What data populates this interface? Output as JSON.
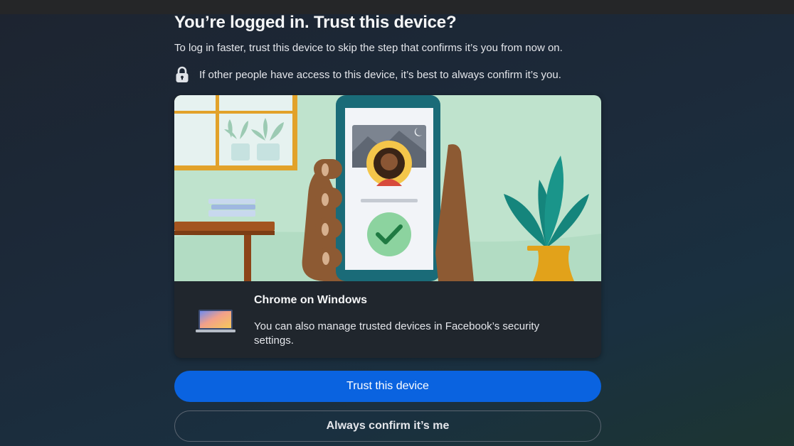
{
  "dialog": {
    "title": "You’re logged in. Trust this device?",
    "subtitle": "To log in faster, trust this device to skip the step that confirms it’s you from now on.",
    "notice": {
      "icon": "lock-icon",
      "text": "If other people have access to this device, it’s best to always confirm it’s you."
    }
  },
  "device": {
    "icon": "laptop-icon",
    "name": "Chrome on Windows",
    "description": "You can also manage trusted devices in Facebook’s security settings."
  },
  "actions": {
    "trust_label": "Trust this device",
    "confirm_label": "Always confirm it’s me"
  },
  "colors": {
    "primary_button": "#0a63e0",
    "background": "#1c2a3a",
    "card": "#20262d"
  }
}
